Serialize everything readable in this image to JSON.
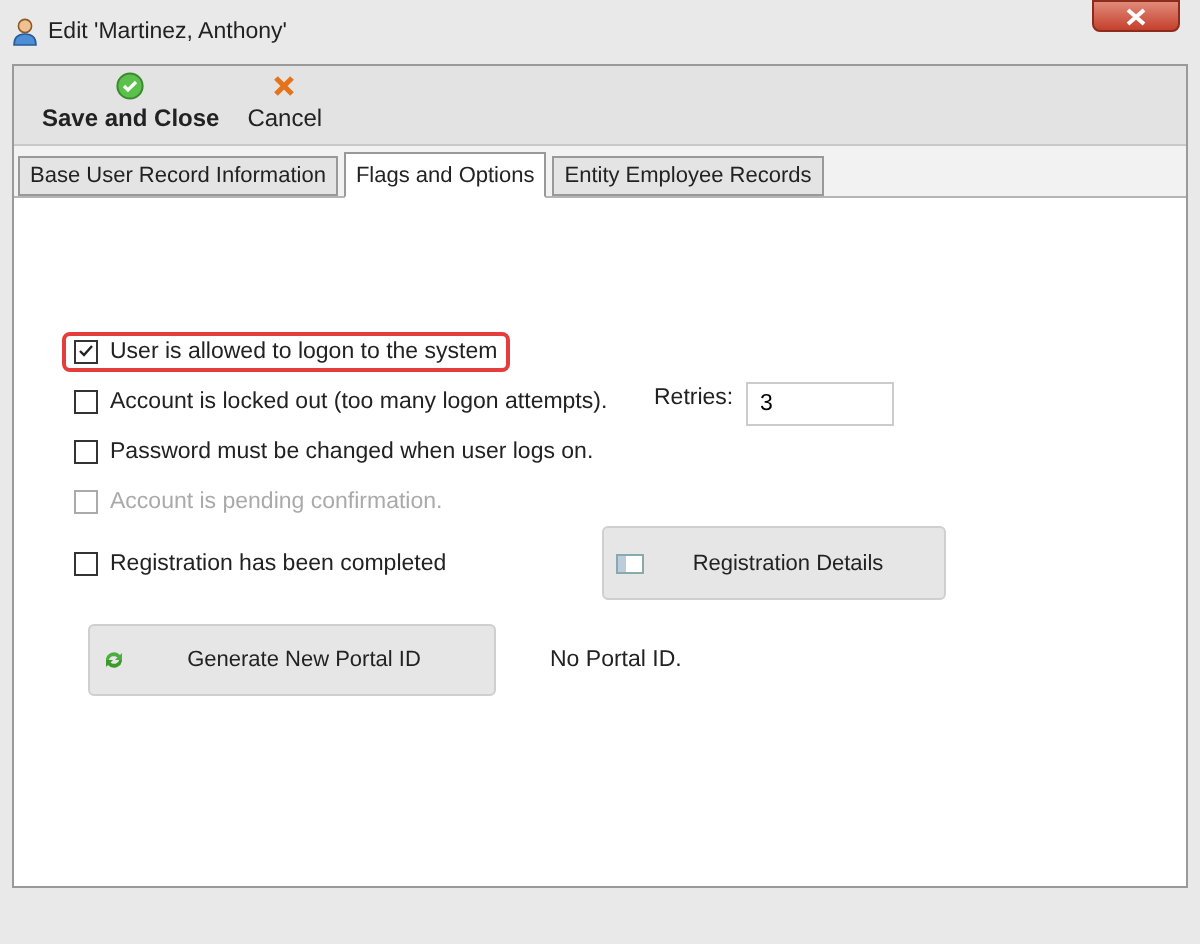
{
  "window": {
    "title": "Edit 'Martinez, Anthony'"
  },
  "toolbar": [
    {
      "label": "Save and Close",
      "kind": "save"
    },
    {
      "label": "Cancel",
      "kind": "cancel"
    }
  ],
  "tabs": [
    {
      "label": "Base User Record Information",
      "selected": false
    },
    {
      "label": "Flags and Options",
      "selected": true
    },
    {
      "label": "Entity Employee Records",
      "selected": false
    }
  ],
  "options": [
    {
      "label": "User is allowed to logon to the system",
      "checked": true,
      "disabled": false,
      "highlighted": true
    },
    {
      "label": "Account is locked out (too many logon attempts).",
      "checked": false,
      "disabled": false,
      "highlighted": false,
      "retries": {
        "label": "Retries:",
        "value": "3"
      }
    },
    {
      "label": "Password must be changed when user logs on.",
      "checked": false,
      "disabled": false,
      "highlighted": false
    },
    {
      "label": "Account is pending confirmation.",
      "checked": false,
      "disabled": true,
      "highlighted": false
    },
    {
      "label": "Registration has been completed",
      "checked": false,
      "disabled": false,
      "highlighted": false,
      "button": "Registration Details"
    }
  ],
  "portal": {
    "button": "Generate New Portal ID",
    "status": "No Portal ID."
  }
}
